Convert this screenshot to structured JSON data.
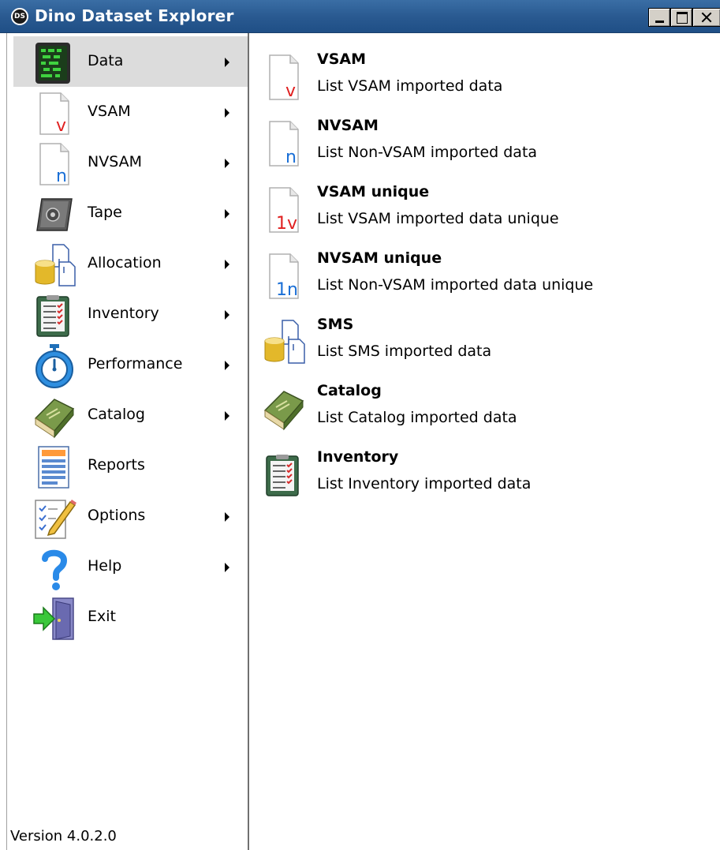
{
  "window": {
    "title": "Dino Dataset Explorer",
    "logo_text": "DS"
  },
  "menu": {
    "items": [
      {
        "label": "Data",
        "icon": "data-icon",
        "has_submenu": true,
        "selected": true
      },
      {
        "label": "VSAM",
        "icon": "vsam-file-icon",
        "has_submenu": true
      },
      {
        "label": "NVSAM",
        "icon": "nvsam-file-icon",
        "has_submenu": true
      },
      {
        "label": "Tape",
        "icon": "tape-icon",
        "has_submenu": true
      },
      {
        "label": "Allocation",
        "icon": "allocation-icon",
        "has_submenu": true
      },
      {
        "label": "Inventory",
        "icon": "inventory-icon",
        "has_submenu": true
      },
      {
        "label": "Performance",
        "icon": "stopwatch-icon",
        "has_submenu": true
      },
      {
        "label": "Catalog",
        "icon": "catalog-book-icon",
        "has_submenu": true
      },
      {
        "label": "Reports",
        "icon": "reports-icon",
        "has_submenu": false
      },
      {
        "label": "Options",
        "icon": "options-icon",
        "has_submenu": true
      },
      {
        "label": "Help",
        "icon": "help-icon",
        "has_submenu": true
      },
      {
        "label": "Exit",
        "icon": "exit-icon",
        "has_submenu": false
      }
    ]
  },
  "submenu": {
    "items": [
      {
        "title": "VSAM",
        "description": "List VSAM imported data",
        "icon": "vsam-file-icon",
        "icon_text": "v"
      },
      {
        "title": "NVSAM",
        "description": "List Non-VSAM imported data",
        "icon": "nvsam-file-icon",
        "icon_text": "n"
      },
      {
        "title": "VSAM unique",
        "description": "List VSAM imported data unique",
        "icon": "vsam-unique-file-icon",
        "icon_text": "1v"
      },
      {
        "title": "NVSAM unique",
        "description": "List Non-VSAM imported data unique",
        "icon": "nvsam-unique-file-icon",
        "icon_text": "1n"
      },
      {
        "title": "SMS",
        "description": "List SMS imported data",
        "icon": "sms-icon"
      },
      {
        "title": "Catalog",
        "description": "List Catalog imported data",
        "icon": "catalog-book-icon"
      },
      {
        "title": "Inventory",
        "description": "List Inventory imported data",
        "icon": "inventory-icon"
      }
    ]
  },
  "status": {
    "version": "Version 4.0.2.0"
  },
  "colors": {
    "titlebar": "#2a5a91",
    "selected_bg": "#dcdcdc",
    "vsam_red": "#e02020",
    "nvsam_blue": "#1a6fd6",
    "inventory_green": "#3d6b4a"
  }
}
